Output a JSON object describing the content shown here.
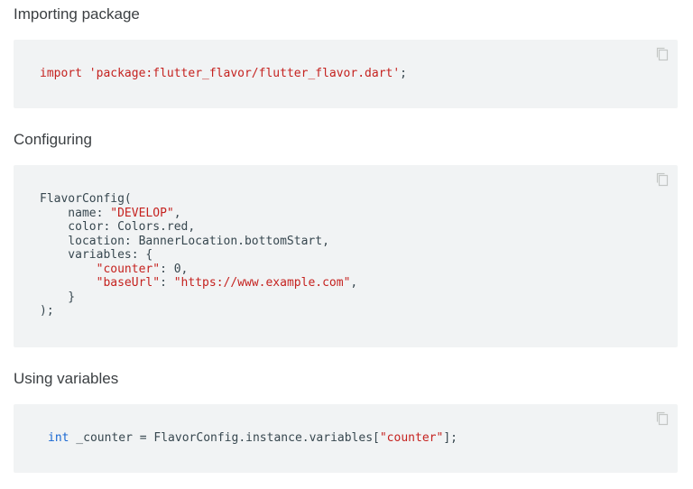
{
  "sections": [
    {
      "heading": "Importing package",
      "code": {
        "kw": "import",
        "str": "'package:flutter_flavor/flutter_flavor.dart'",
        "end": ";"
      }
    },
    {
      "heading": "Configuring",
      "code": {
        "l1": "FlavorConfig(",
        "l2a": "    name: ",
        "l2s": "\"DEVELOP\"",
        "l2b": ",",
        "l3": "    color: Colors.red,",
        "l4": "    location: BannerLocation.bottomStart,",
        "l5": "    variables: {",
        "l6pre": "        ",
        "l6s": "\"counter\"",
        "l6b": ": 0,",
        "l7pre": "        ",
        "l7s": "\"baseUrl\"",
        "l7c": ": ",
        "l7v": "\"https://www.example.com\"",
        "l7b": ",",
        "l8": "    }",
        "l9": ");"
      }
    },
    {
      "heading": "Using variables",
      "code": {
        "type": "int",
        "mid": " _counter = FlavorConfig.instance.variables[",
        "str": "\"counter\"",
        "end": "];"
      }
    }
  ],
  "icons": {
    "copy": "copy-icon"
  },
  "colors": {
    "code_bg": "#f1f3f4",
    "string": "#c5221f",
    "type": "#1967d2"
  }
}
